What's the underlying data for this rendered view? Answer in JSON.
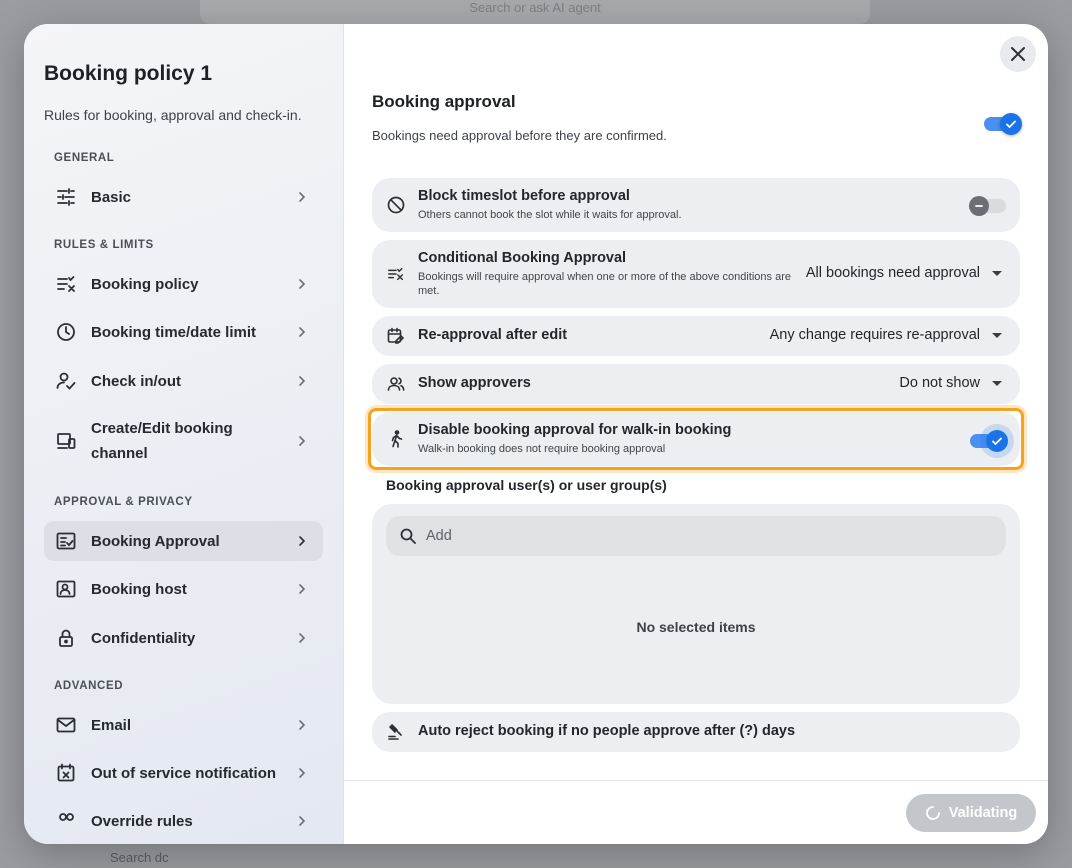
{
  "background": {
    "search_placeholder": "Search or ask AI agent",
    "bottom_text": "Search dc"
  },
  "sidebar": {
    "title": "Booking policy 1",
    "subtitle": "Rules for booking, approval and check-in.",
    "sections": {
      "general": "GENERAL",
      "rules": "RULES & LIMITS",
      "approval": "APPROVAL & PRIVACY",
      "advanced": "ADVANCED"
    },
    "items": [
      {
        "label": "Basic",
        "icon": "sliders-icon"
      },
      {
        "label": "Booking policy",
        "icon": "rule-icon"
      },
      {
        "label": "Booking time/date limit",
        "icon": "clock-icon"
      },
      {
        "label": "Check in/out",
        "icon": "person-check-icon"
      },
      {
        "label": "Create/Edit booking channel",
        "icon": "devices-icon"
      },
      {
        "label": "Booking Approval",
        "icon": "approval-icon",
        "active": true
      },
      {
        "label": "Booking host",
        "icon": "badge-icon"
      },
      {
        "label": "Confidentiality",
        "icon": "lock-icon"
      },
      {
        "label": "Email",
        "icon": "mail-icon"
      },
      {
        "label": "Out of service notification",
        "icon": "calendar-x-icon"
      },
      {
        "label": "Override rules",
        "icon": "override-icon"
      }
    ]
  },
  "main": {
    "title": "Booking approval",
    "description": "Bookings need approval before they are confirmed.",
    "approval_enabled": true,
    "rows": {
      "block": {
        "title": "Block timeslot before approval",
        "sub": "Others cannot book the slot while it waits for approval.",
        "enabled": false
      },
      "conditional": {
        "title": "Conditional Booking Approval",
        "sub": "Bookings will require approval when one or more of the above conditions are met.",
        "value": "All bookings need approval"
      },
      "reapproval": {
        "title": "Re-approval after edit",
        "value": "Any change requires re-approval"
      },
      "approvers": {
        "title": "Show approvers",
        "value": "Do not show"
      },
      "walkin": {
        "title": "Disable booking approval for walk-in booking",
        "sub": "Walk-in booking does not require booking approval",
        "enabled": true
      },
      "autoreject": {
        "title": "Auto reject booking if no people approve after (?) days"
      }
    },
    "approvers_label": "Booking approval user(s) or user group(s)",
    "search_placeholder": "Add",
    "empty_text": "No selected items"
  },
  "footer": {
    "validate_label": "Validating"
  },
  "colors": {
    "accent": "#1a73e8",
    "highlight": "#f4a31f"
  }
}
